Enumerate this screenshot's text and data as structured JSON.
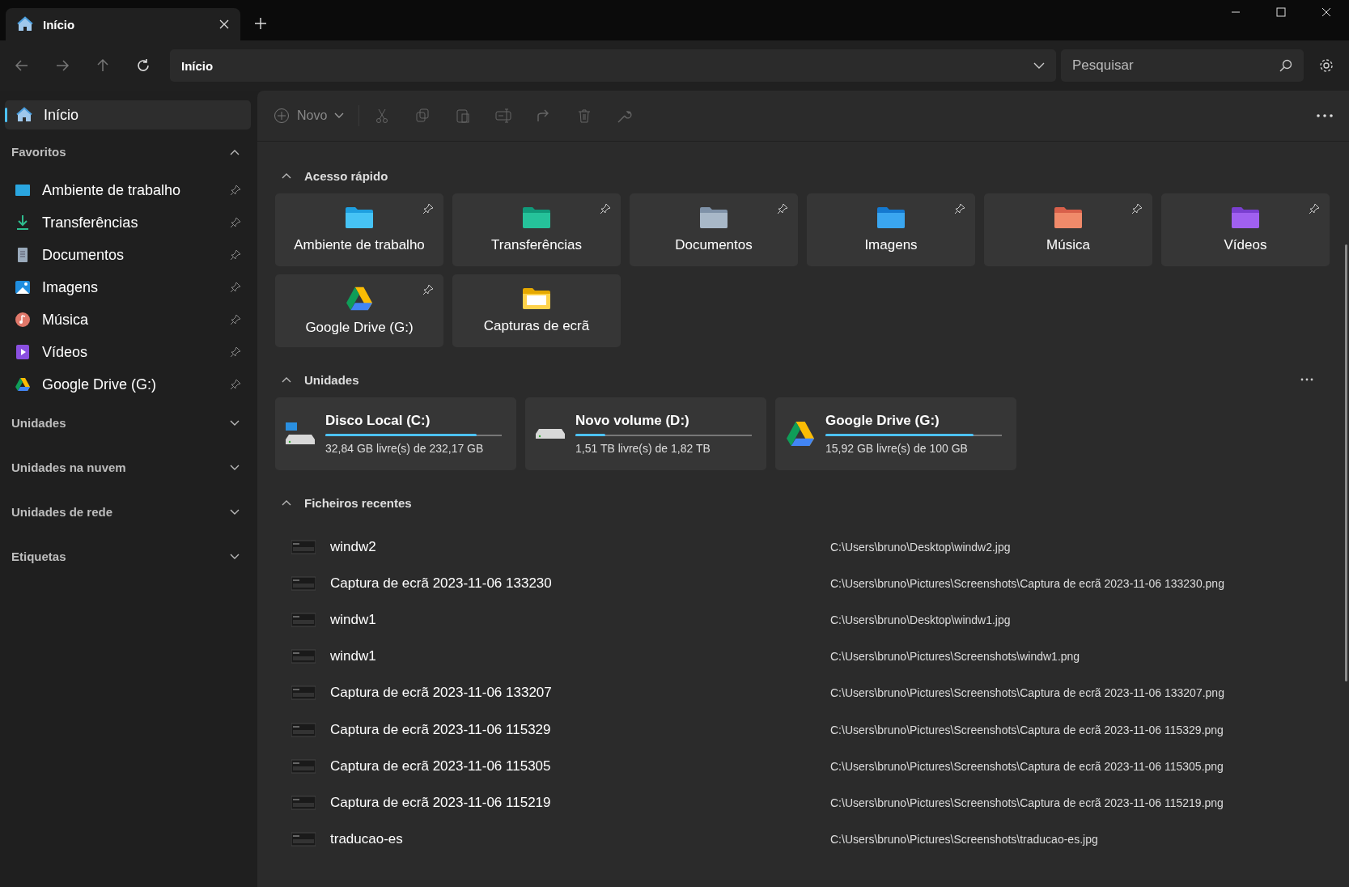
{
  "tabs": [
    {
      "label": "Início",
      "selected": true
    }
  ],
  "address": {
    "value": "Início"
  },
  "search": {
    "placeholder": "Pesquisar"
  },
  "sidebar": {
    "home": {
      "label": "Início",
      "selected": true
    },
    "sections": [
      {
        "title": "Favoritos",
        "expanded": true,
        "items": [
          {
            "label": "Ambiente de trabalho",
            "kind": "desktop"
          },
          {
            "label": "Transferências",
            "kind": "downloads"
          },
          {
            "label": "Documentos",
            "kind": "documents"
          },
          {
            "label": "Imagens",
            "kind": "pictures"
          },
          {
            "label": "Música",
            "kind": "music"
          },
          {
            "label": "Vídeos",
            "kind": "videos"
          },
          {
            "label": "Google Drive (G:)",
            "kind": "gdrive"
          }
        ]
      },
      {
        "title": "Unidades",
        "expanded": false
      },
      {
        "title": "Unidades na nuvem",
        "expanded": false
      },
      {
        "title": "Unidades de rede",
        "expanded": false
      },
      {
        "title": "Etiquetas",
        "expanded": false
      }
    ]
  },
  "toolbar": {
    "new_label": "Novo"
  },
  "quick_access": {
    "title": "Acesso rápido",
    "expanded": true,
    "items": [
      {
        "label": "Ambiente de trabalho",
        "kind": "desktop",
        "pinned": true
      },
      {
        "label": "Transferências",
        "kind": "downloads",
        "pinned": true
      },
      {
        "label": "Documentos",
        "kind": "documents",
        "pinned": true
      },
      {
        "label": "Imagens",
        "kind": "pictures",
        "pinned": true
      },
      {
        "label": "Música",
        "kind": "music",
        "pinned": true
      },
      {
        "label": "Vídeos",
        "kind": "videos",
        "pinned": true
      },
      {
        "label": "Google Drive (G:)",
        "kind": "gdrive",
        "pinned": true
      },
      {
        "label": "Capturas de ecrã",
        "kind": "folder",
        "pinned": false
      }
    ]
  },
  "drives": {
    "title": "Unidades",
    "expanded": true,
    "items": [
      {
        "name": "Disco Local (C:)",
        "kind": "system",
        "level": 0.86,
        "free": "32,84 GB livre(s) de 232,17 GB"
      },
      {
        "name": "Novo volume (D:)",
        "kind": "hdd",
        "level": 0.17,
        "free": "1,51 TB livre(s) de 1,82 TB"
      },
      {
        "name": "Google Drive (G:)",
        "kind": "gdrive",
        "level": 0.84,
        "free": "15,92 GB livre(s) de 100 GB"
      }
    ]
  },
  "recent": {
    "title": "Ficheiros recentes",
    "expanded": true,
    "items": [
      {
        "name": "windw2",
        "path": "C:\\Users\\bruno\\Desktop\\windw2.jpg"
      },
      {
        "name": "Captura de ecrã 2023-11-06 133230",
        "path": "C:\\Users\\bruno\\Pictures\\Screenshots\\Captura de ecrã 2023-11-06 133230.png"
      },
      {
        "name": "windw1",
        "path": "C:\\Users\\bruno\\Desktop\\windw1.jpg"
      },
      {
        "name": "windw1",
        "path": "C:\\Users\\bruno\\Pictures\\Screenshots\\windw1.png"
      },
      {
        "name": "Captura de ecrã 2023-11-06 133207",
        "path": "C:\\Users\\bruno\\Pictures\\Screenshots\\Captura de ecrã 2023-11-06 133207.png"
      },
      {
        "name": "Captura de ecrã 2023-11-06 115329",
        "path": "C:\\Users\\bruno\\Pictures\\Screenshots\\Captura de ecrã 2023-11-06 115329.png"
      },
      {
        "name": "Captura de ecrã 2023-11-06 115305",
        "path": "C:\\Users\\bruno\\Pictures\\Screenshots\\Captura de ecrã 2023-11-06 115305.png"
      },
      {
        "name": "Captura de ecrã 2023-11-06 115219",
        "path": "C:\\Users\\bruno\\Pictures\\Screenshots\\Captura de ecrã 2023-11-06 115219.png"
      },
      {
        "name": "traducao-es",
        "path": "C:\\Users\\bruno\\Pictures\\Screenshots\\traducao-es.jpg"
      }
    ]
  }
}
